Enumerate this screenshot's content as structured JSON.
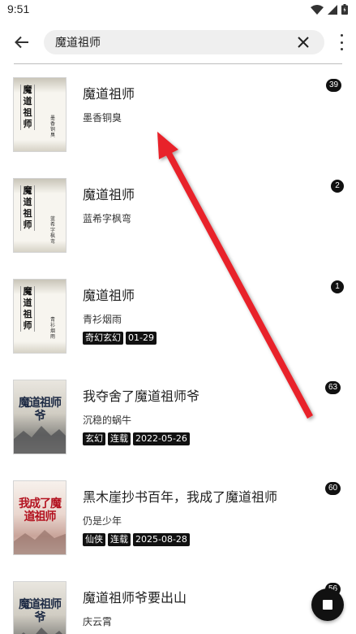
{
  "status_bar": {
    "time": "9:51"
  },
  "search": {
    "query": "魔道祖师",
    "placeholder": ""
  },
  "results": [
    {
      "title": "魔道祖师",
      "author": "墨香铜臭",
      "tags": [],
      "badge": "39",
      "cover": {
        "style": "plain",
        "title": "魔道祖师",
        "author": "墨香铜臭"
      }
    },
    {
      "title": "魔道祖师",
      "author": "蓝希字枫弯",
      "tags": [],
      "badge": "2",
      "cover": {
        "style": "plain",
        "title": "魔道祖师",
        "author": "蓝希字枫弯"
      }
    },
    {
      "title": "魔道祖师",
      "author": "青衫烟雨",
      "tags": [
        "奇幻玄幻",
        "01-29"
      ],
      "badge": "1",
      "cover": {
        "style": "plain",
        "title": "魔道祖师",
        "author": "青衫烟雨"
      }
    },
    {
      "title": "我夺舍了魔道祖师爷",
      "author": "沉稳的蜗牛",
      "tags": [
        "玄幻",
        "连载",
        "2022-05-26"
      ],
      "badge": "63",
      "cover": {
        "style": "art",
        "title": "魔道祖师爷"
      }
    },
    {
      "title": "黑木崖抄书百年，我成了魔道祖师",
      "author": "仍是少年",
      "tags": [
        "仙侠",
        "连载",
        "2025-08-28"
      ],
      "badge": "60",
      "cover": {
        "style": "art-pink",
        "title": "我成了魔道祖师"
      }
    },
    {
      "title": "魔道祖师爷要出山",
      "author": "庆云霄",
      "tags": [],
      "badge": "56",
      "cover": {
        "style": "art",
        "title": "魔道祖师爷"
      }
    }
  ],
  "icons": {
    "back": "arrow-left-icon",
    "clear": "close-icon",
    "more": "more-vertical-icon",
    "fab": "stop-icon",
    "annotation": "red-arrow"
  },
  "colors": {
    "annotation_arrow": "#e8232a",
    "tag_bg": "#111111",
    "search_bg": "#efefef"
  }
}
